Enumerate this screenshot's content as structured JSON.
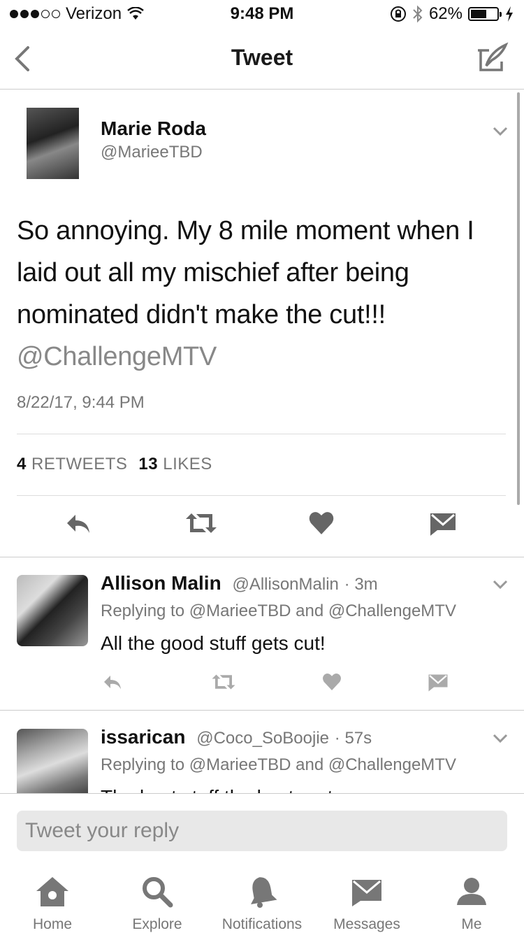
{
  "status_bar": {
    "carrier": "Verizon",
    "time": "9:48 PM",
    "battery_percent": "62%",
    "battery_level": 0.62
  },
  "nav": {
    "title": "Tweet"
  },
  "tweet": {
    "author_name": "Marie Roda",
    "author_handle": "@MarieeTBD",
    "text": "So annoying. My 8 mile moment when I laid out all my mischief after being nominated didn't make the cut!!!",
    "mention": "@ChallengeMTV",
    "date": "8/22/17, 9:44 PM",
    "retweets_count": "4",
    "retweets_label": "RETWEETS",
    "likes_count": "13",
    "likes_label": "LIKES"
  },
  "replies": [
    {
      "name": "Allison Malin",
      "handle": "@AllisonMalin",
      "time": "· 3m",
      "replying_to": "Replying to @MarieeTBD and @ChallengeMTV",
      "text": "All the good stuff gets cut!"
    },
    {
      "name": "issarican",
      "handle": "@Coco_SoBoojie",
      "time": "· 57s",
      "replying_to": "Replying to @MarieeTBD and @ChallengeMTV",
      "text": "The best stuff the best part"
    }
  ],
  "reply_box": {
    "placeholder": "Tweet your reply"
  },
  "tabs": [
    {
      "label": "Home",
      "icon": "home-icon"
    },
    {
      "label": "Explore",
      "icon": "search-icon"
    },
    {
      "label": "Notifications",
      "icon": "bell-icon"
    },
    {
      "label": "Messages",
      "icon": "envelope-icon"
    },
    {
      "label": "Me",
      "icon": "person-icon"
    }
  ],
  "colors": {
    "text": "#111111",
    "secondary": "#777777",
    "divider": "#cccccc"
  }
}
